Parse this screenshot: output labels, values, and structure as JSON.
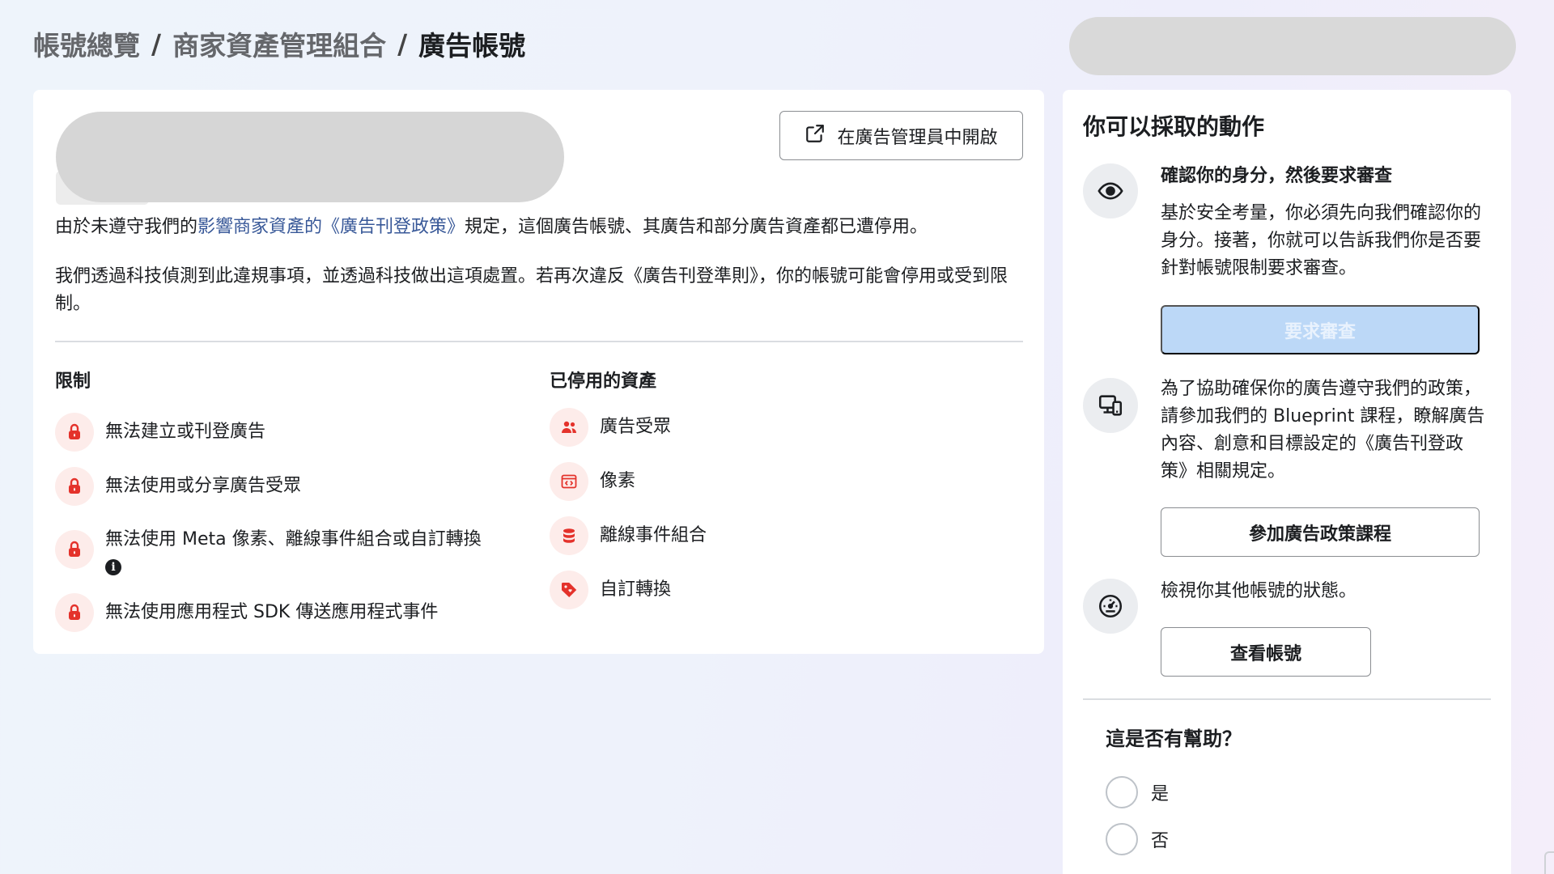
{
  "breadcrumb": {
    "items": [
      "帳號總覽",
      "商家資產管理組合",
      "廣告帳號"
    ],
    "separator": "/"
  },
  "main": {
    "open_button_label": "在廣告管理員中開啟",
    "notice_before": "由於未遵守我們的",
    "notice_link": "影響商家資產的《廣告刊登政策》",
    "notice_after": "規定，這個廣告帳號、其廣告和部分廣告資產都已遭停用。",
    "detection_text": "我們透過科技偵測到此違規事項，並透過科技做出這項處置。若再次違反《廣告刊登準則》，你的帳號可能會停用或受到限制。",
    "restrictions_title": "限制",
    "restrictions": [
      "無法建立或刊登廣告",
      "無法使用或分享廣告受眾",
      "無法使用 Meta 像素、離線事件組合或自訂轉換",
      "無法使用應用程式 SDK 傳送應用程式事件"
    ],
    "disabled_assets_title": "已停用的資產",
    "disabled_assets": [
      "廣告受眾",
      "像素",
      "離線事件組合",
      "自訂轉換"
    ]
  },
  "side": {
    "title": "你可以採取的動作",
    "verify_title": "確認你的身分，然後要求審查",
    "verify_text": "基於安全考量，你必須先向我們確認你的身分。接著，你就可以告訴我們你是否要針對帳號限制要求審查。",
    "request_review_label": "要求審查",
    "blueprint_text": "為了協助確保你的廣告遵守我們的政策，請參加我們的 Blueprint 課程，瞭解廣告內容、創意和目標設定的《廣告刊登政策》相關規定。",
    "course_button_label": "參加廣告政策課程",
    "status_text": "檢視你其他帳號的狀態。",
    "view_accounts_label": "查看帳號",
    "helpful_title": "這是否有幫助？",
    "yes_label": "是",
    "no_label": "否"
  },
  "colors": {
    "link": "#385898",
    "restriction_icon": "#e4322b",
    "restriction_icon_bg": "#fdecea",
    "disabled_button": "#bcd8f7"
  },
  "icons": {
    "open_button": "external-link-icon",
    "restriction": "lock-icon",
    "assets": [
      "people-icon",
      "pixel-icon",
      "database-icon",
      "tag-icon"
    ],
    "side": [
      "eye-icon",
      "devices-icon",
      "gauge-icon"
    ]
  }
}
